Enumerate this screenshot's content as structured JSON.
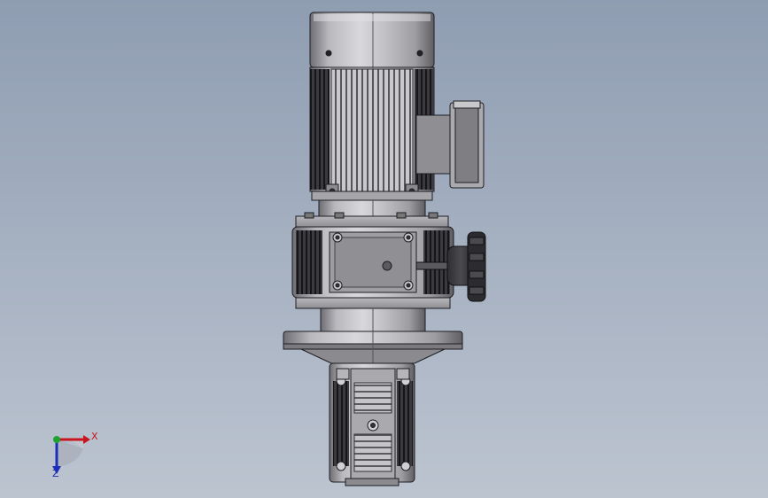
{
  "viewport": {
    "background_top": "#8f9db2",
    "background_bottom": "#bcc4d0"
  },
  "triad": {
    "x_label": "X",
    "z_label": "Z",
    "x_color": "#c8141c",
    "y_color": "#1fa22e",
    "z_color": "#1d2fb8"
  }
}
